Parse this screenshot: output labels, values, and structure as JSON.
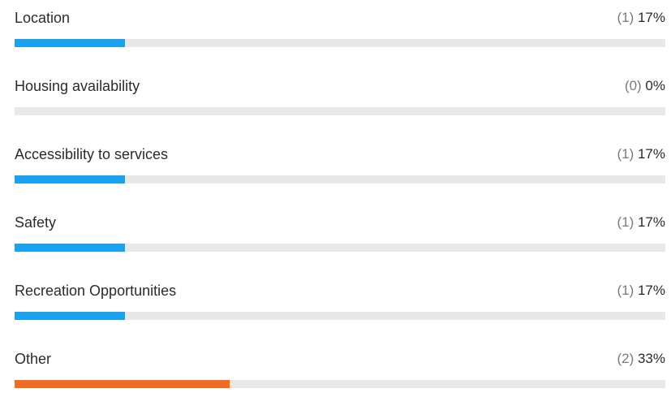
{
  "results": [
    {
      "label": "Location",
      "count": "(1)",
      "percent": "17%",
      "fraction": 0.17,
      "color": "#1aa1ef"
    },
    {
      "label": "Housing availability",
      "count": "(0)",
      "percent": "0%",
      "fraction": 0.0,
      "color": "#1aa1ef"
    },
    {
      "label": "Accessibility to services",
      "count": "(1)",
      "percent": "17%",
      "fraction": 0.17,
      "color": "#1aa1ef"
    },
    {
      "label": "Safety",
      "count": "(1)",
      "percent": "17%",
      "fraction": 0.17,
      "color": "#1aa1ef"
    },
    {
      "label": "Recreation Opportunities",
      "count": "(1)",
      "percent": "17%",
      "fraction": 0.17,
      "color": "#1aa1ef"
    },
    {
      "label": "Other",
      "count": "(2)",
      "percent": "33%",
      "fraction": 0.33,
      "color": "#ee6c23"
    }
  ],
  "track_color": "#e8e8e8"
}
